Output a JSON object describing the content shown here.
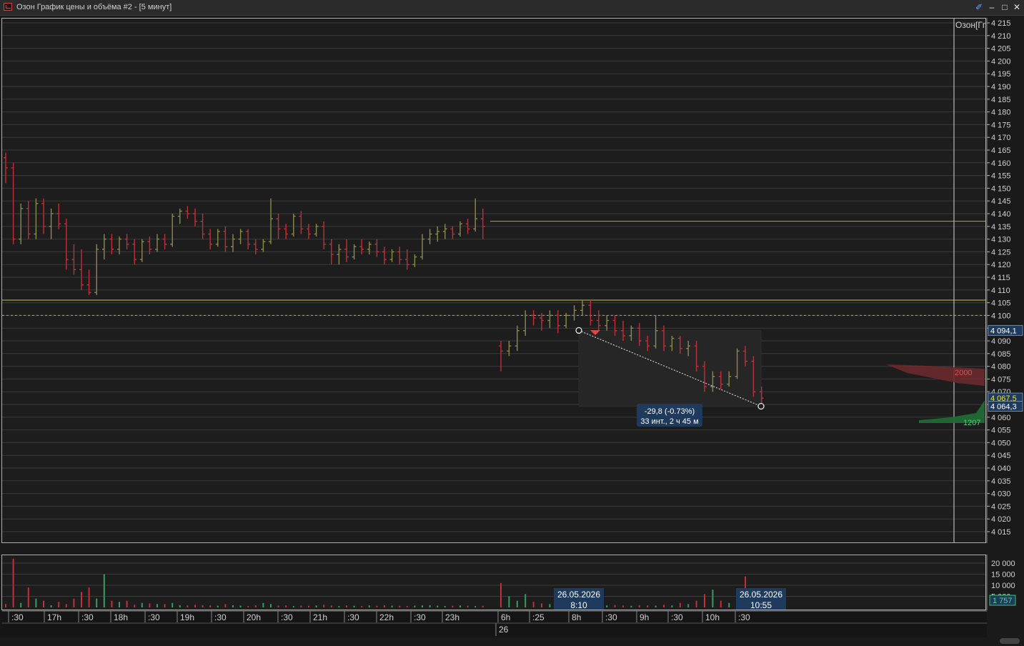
{
  "window": {
    "title": "Озон График цены и объёма #2 - [5 минут]",
    "buttons": {
      "pin": "✐",
      "minimize": "–",
      "maximize": "□",
      "close": "✕"
    }
  },
  "instrument_label": "Озон[Гг",
  "price_axis": {
    "ticks": [
      "4 215",
      "4 210",
      "4 205",
      "4 200",
      "4 195",
      "4 190",
      "4 185",
      "4 180",
      "4 175",
      "4 170",
      "4 165",
      "4 160",
      "4 155",
      "4 150",
      "4 145",
      "4 140",
      "4 135",
      "4 130",
      "4 125",
      "4 120",
      "4 115",
      "4 110",
      "4 105",
      "4 100",
      "4 095",
      "4 090",
      "4 085",
      "4 080",
      "4 075",
      "4 070",
      "4 065",
      "4 060",
      "4 055",
      "4 050",
      "4 045",
      "4 040",
      "4 035",
      "4 030",
      "4 025",
      "4 020",
      "4 015"
    ],
    "marker_high": "4 094,1",
    "marker_last": "4 067,5",
    "marker_low": "4 064,3",
    "profile_red_label": "2000",
    "profile_green_label": "1207"
  },
  "volume_axis": {
    "ticks": [
      "20 000",
      "15 000",
      "10 000",
      "5 000"
    ],
    "current": "1 757"
  },
  "time_axis": {
    "labels": [
      ":30",
      "17h",
      ":30",
      "18h",
      ":30",
      "19h",
      ":30",
      "20h",
      ":30",
      "21h",
      ":30",
      "22h",
      ":30",
      "23h",
      "6h",
      ":25",
      "8h",
      ":30",
      "9h",
      ":30",
      "10h",
      ":30"
    ],
    "date_label": "26"
  },
  "measure": {
    "change": "-29,8 (-0.73%)",
    "duration": "33 инт., 2 ч 45 м",
    "start_date": "26.05.2026",
    "start_time": "8:10",
    "end_date": "26.05.2026",
    "end_time": "10:55"
  },
  "colors": {
    "up": "#8a8a4a",
    "down": "#c0303a",
    "level_orange": "#d99a1e",
    "level_yellow": "#c8c832",
    "dashed_level": "#e0a020",
    "label_bg": "#1e3a5c",
    "green_vol": "#2fa060"
  },
  "chart_data": {
    "type": "ohlc",
    "interval": "5 минут",
    "ylim": [
      4012,
      4216
    ],
    "levels": [
      4137,
      4106,
      4100
    ],
    "candles": [
      [
        4162,
        4164,
        4152,
        4158
      ],
      [
        4158,
        4160,
        4128,
        4130
      ],
      [
        4130,
        4144,
        4128,
        4142
      ],
      [
        4142,
        4145,
        4130,
        4132
      ],
      [
        4132,
        4146,
        4130,
        4144
      ],
      [
        4144,
        4146,
        4132,
        4135
      ],
      [
        4135,
        4142,
        4130,
        4140
      ],
      [
        4140,
        4144,
        4134,
        4136
      ],
      [
        4136,
        4138,
        4118,
        4122
      ],
      [
        4122,
        4128,
        4116,
        4118
      ],
      [
        4118,
        4126,
        4110,
        4112
      ],
      [
        4112,
        4118,
        4108,
        4109
      ],
      [
        4109,
        4128,
        4108,
        4126
      ],
      [
        4126,
        4132,
        4122,
        4130
      ],
      [
        4130,
        4132,
        4124,
        4126
      ],
      [
        4126,
        4131,
        4124,
        4130
      ],
      [
        4130,
        4132,
        4126,
        4128
      ],
      [
        4128,
        4130,
        4120,
        4122
      ],
      [
        4122,
        4130,
        4121,
        4129
      ],
      [
        4129,
        4131,
        4124,
        4126
      ],
      [
        4126,
        4132,
        4125,
        4130
      ],
      [
        4130,
        4132,
        4126,
        4128
      ],
      [
        4128,
        4140,
        4127,
        4139
      ],
      [
        4139,
        4142,
        4136,
        4141
      ],
      [
        4141,
        4143,
        4138,
        4140
      ],
      [
        4140,
        4142,
        4135,
        4137
      ],
      [
        4137,
        4140,
        4130,
        4132
      ],
      [
        4132,
        4134,
        4126,
        4128
      ],
      [
        4128,
        4134,
        4127,
        4133
      ],
      [
        4133,
        4135,
        4125,
        4127
      ],
      [
        4127,
        4132,
        4125,
        4130
      ],
      [
        4130,
        4134,
        4128,
        4133
      ],
      [
        4133,
        4134,
        4126,
        4128
      ],
      [
        4128,
        4130,
        4124,
        4126
      ],
      [
        4126,
        4130,
        4125,
        4129
      ],
      [
        4129,
        4146,
        4128,
        4138
      ],
      [
        4138,
        4140,
        4130,
        4134
      ],
      [
        4134,
        4136,
        4130,
        4132
      ],
      [
        4132,
        4140,
        4131,
        4139
      ],
      [
        4139,
        4141,
        4132,
        4134
      ],
      [
        4134,
        4136,
        4130,
        4132
      ],
      [
        4132,
        4136,
        4131,
        4135
      ],
      [
        4135,
        4137,
        4126,
        4128
      ],
      [
        4128,
        4130,
        4120,
        4124
      ],
      [
        4124,
        4128,
        4120,
        4126
      ],
      [
        4126,
        4130,
        4121,
        4123
      ],
      [
        4123,
        4128,
        4122,
        4127
      ],
      [
        4127,
        4130,
        4124,
        4126
      ],
      [
        4126,
        4129,
        4124,
        4128
      ],
      [
        4128,
        4130,
        4123,
        4125
      ],
      [
        4125,
        4127,
        4120,
        4122
      ],
      [
        4122,
        4126,
        4121,
        4125
      ],
      [
        4125,
        4127,
        4120,
        4122
      ],
      [
        4122,
        4126,
        4118,
        4120
      ],
      [
        4120,
        4124,
        4119,
        4123
      ],
      [
        4123,
        4132,
        4122,
        4130
      ],
      [
        4130,
        4134,
        4128,
        4132
      ],
      [
        4132,
        4135,
        4129,
        4133
      ],
      [
        4133,
        4136,
        4130,
        4134
      ],
      [
        4134,
        4135,
        4130,
        4132
      ],
      [
        4132,
        4137,
        4131,
        4136
      ],
      [
        4136,
        4138,
        4132,
        4134
      ],
      [
        4134,
        4146,
        4133,
        4138
      ],
      [
        4138,
        4142,
        4130,
        4135
      ],
      [
        4088,
        4090,
        4078,
        4086
      ],
      [
        4086,
        4090,
        4084,
        4088
      ],
      [
        4088,
        4096,
        4086,
        4094
      ],
      [
        4094,
        4102,
        4092,
        4100
      ],
      [
        4100,
        4102,
        4096,
        4099
      ],
      [
        4099,
        4101,
        4094,
        4098
      ],
      [
        4098,
        4102,
        4095,
        4100
      ],
      [
        4100,
        4102,
        4093,
        4096
      ],
      [
        4096,
        4101,
        4095,
        4100
      ],
      [
        4100,
        4104,
        4098,
        4102
      ],
      [
        4102,
        4106,
        4100,
        4104
      ],
      [
        4104,
        4106,
        4096,
        4098
      ],
      [
        4098,
        4102,
        4094,
        4096
      ],
      [
        4096,
        4100,
        4094,
        4098
      ],
      [
        4098,
        4100,
        4092,
        4094
      ],
      [
        4094,
        4098,
        4090,
        4092
      ],
      [
        4092,
        4096,
        4090,
        4095
      ],
      [
        4095,
        4097,
        4088,
        4090
      ],
      [
        4090,
        4092,
        4086,
        4088
      ],
      [
        4088,
        4100,
        4087,
        4094
      ],
      [
        4094,
        4096,
        4086,
        4088
      ],
      [
        4088,
        4092,
        4086,
        4091
      ],
      [
        4091,
        4092,
        4085,
        4087
      ],
      [
        4087,
        4090,
        4084,
        4088
      ],
      [
        4088,
        4090,
        4078,
        4080
      ],
      [
        4080,
        4082,
        4070,
        4072
      ],
      [
        4072,
        4078,
        4070,
        4076
      ],
      [
        4076,
        4078,
        4071,
        4073
      ],
      [
        4073,
        4078,
        4072,
        4076
      ],
      [
        4076,
        4087,
        4075,
        4086
      ],
      [
        4086,
        4088,
        4080,
        4082
      ],
      [
        4082,
        4084,
        4068,
        4070
      ],
      [
        4070,
        4072,
        4064,
        4067.5
      ]
    ],
    "volume": [
      1500,
      22000,
      2000,
      9000,
      4000,
      3000,
      1000,
      2500,
      1500,
      4000,
      7000,
      9000,
      4000,
      15000,
      3000,
      2500,
      3000,
      1200,
      2000,
      1800,
      1500,
      1500,
      2000,
      1000,
      900,
      1200,
      1000,
      900,
      800,
      1500,
      1000,
      800,
      600,
      1000,
      2000,
      1500,
      800,
      900,
      600,
      800,
      700,
      900,
      1200,
      800,
      600,
      900,
      700,
      600,
      900,
      700,
      1000,
      800,
      700,
      600,
      800,
      900,
      1000,
      800,
      600,
      700,
      900,
      800,
      600,
      700,
      11000,
      5000,
      3000,
      6000,
      2500,
      1800,
      1500,
      2000,
      1600,
      1200,
      1500,
      1300,
      1000,
      900,
      1100,
      800,
      700,
      1000,
      900,
      800,
      1200,
      900,
      2000,
      1500,
      3000,
      6000,
      8000,
      3000,
      2000,
      2500,
      14000,
      3000,
      1757
    ]
  }
}
